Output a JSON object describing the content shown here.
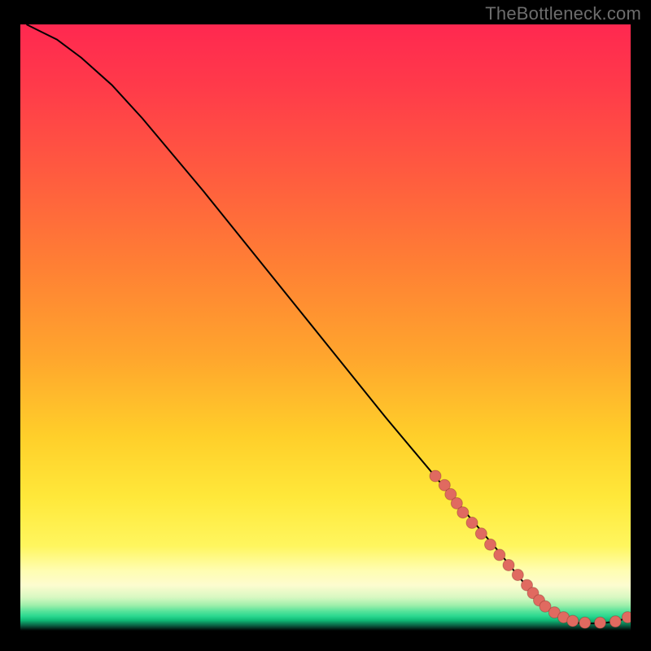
{
  "watermark": "TheBottleneck.com",
  "colors": {
    "background": "#000000",
    "dot": "#e06a60",
    "line": "#000000"
  },
  "chart_data": {
    "type": "line",
    "title": "",
    "xlabel": "",
    "ylabel": "",
    "xlim": [
      0,
      100
    ],
    "ylim": [
      0,
      100
    ],
    "grid": false,
    "legend": false,
    "note": "No axis ticks or numeric labels are rendered in the image; values below are estimated from pixel positions on a 0–100 normalized scale.",
    "series": [
      {
        "name": "curve",
        "style": "line",
        "x": [
          1,
          3,
          6,
          10,
          15,
          20,
          30,
          40,
          50,
          60,
          70,
          78,
          82,
          85,
          88,
          90,
          92,
          94,
          96,
          98,
          99.5
        ],
        "y": [
          100,
          99,
          97.5,
          94.5,
          90,
          84.5,
          72.5,
          60,
          47.5,
          35,
          23,
          13.5,
          8.5,
          5,
          2.5,
          1.5,
          1.2,
          1.2,
          1.3,
          1.6,
          2.2
        ]
      },
      {
        "name": "highlighted-points",
        "style": "scatter",
        "x": [
          68,
          69.5,
          70.5,
          71.5,
          72.5,
          74,
          75.5,
          77,
          78.5,
          80,
          81.5,
          83,
          84,
          85,
          86,
          87.5,
          89,
          90.5,
          92.5,
          95,
          97.5,
          99.5
        ],
        "y": [
          25.5,
          24,
          22.5,
          21,
          19.5,
          17.8,
          16,
          14.2,
          12.5,
          10.8,
          9.2,
          7.5,
          6.2,
          5,
          4,
          3,
          2.2,
          1.6,
          1.3,
          1.3,
          1.5,
          2.2
        ]
      }
    ]
  }
}
